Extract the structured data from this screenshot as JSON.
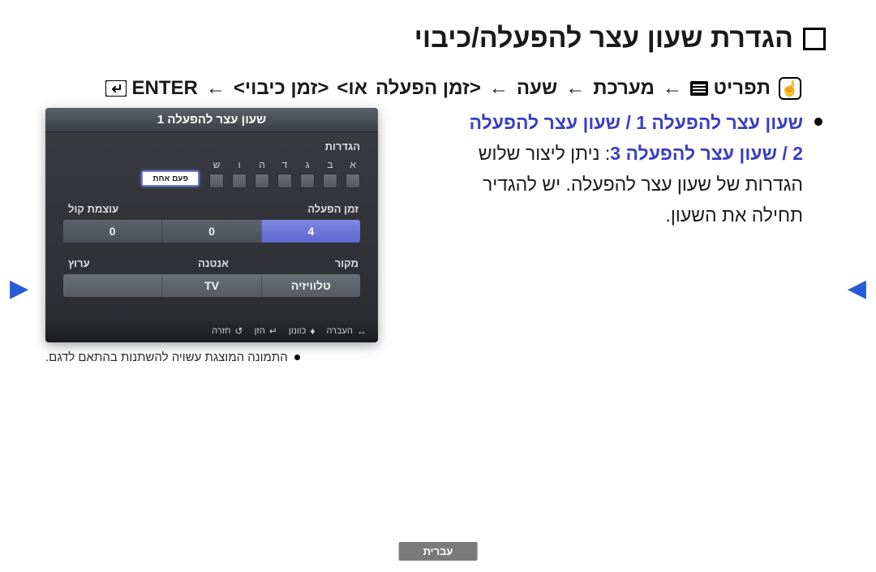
{
  "title": "הגדרת שעון עצר להפעלה/כיבוי",
  "breadcrumb": {
    "menu_label": "תפריט",
    "system": "מערכת",
    "time": "שעה",
    "on_time": "זמן הפעלה",
    "or": "או",
    "off_time": "זמן כיבוי",
    "enter": "ENTER",
    "arrow": "←",
    "angle_open": "<",
    "angle_close": ">"
  },
  "bullet": {
    "line1_emph": "שעון עצר להפעלה 1 / שעון עצר להפעלה",
    "line2_emph": "2 / שעון עצר להפעלה 3",
    "line2_rest": ": ניתן ליצור שלוש",
    "line3": "הגדרות של שעון עצר להפעלה. יש להגדיר",
    "line4": "תחילה את השעון."
  },
  "screenshot": {
    "header": "שעון עצר להפעלה 1",
    "settings_label": "הגדרות",
    "days": [
      "א",
      "ב",
      "ג",
      "ד",
      "ה",
      "ו",
      "ש"
    ],
    "once_label": "פעם אחת",
    "labels_time": {
      "right": "זמן הפעלה",
      "center": "",
      "left": "עוצמת קול"
    },
    "values_time": [
      "4",
      "0",
      "0"
    ],
    "labels_source": {
      "right": "מקור",
      "center": "אנטנה",
      "left": "ערוץ"
    },
    "values_source": [
      "טלוויזיה",
      "TV",
      ""
    ],
    "footer": {
      "move": "העברה",
      "adjust": "כוונון",
      "enter": "הזן",
      "return": "חזרה"
    }
  },
  "caption": "התמונה המוצגת עשויה להשתנות בהתאם לדגם.",
  "lang_pill": "עברית"
}
